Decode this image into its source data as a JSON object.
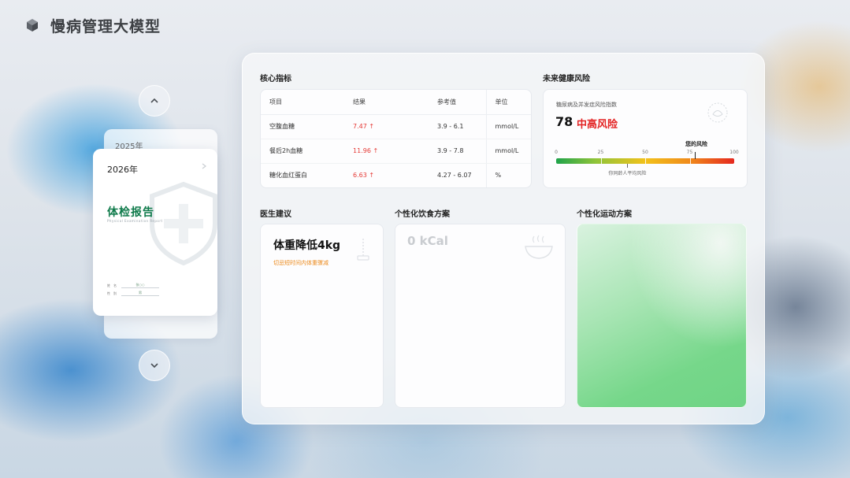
{
  "app": {
    "title": "慢病管理大模型"
  },
  "carousel": {
    "years": [
      "2025年",
      "2026年"
    ],
    "current": {
      "year": "2026年",
      "report_title": "体检报告",
      "report_subtitle": "Physical Examination Report",
      "fields": [
        {
          "label": "姓　名",
          "value": "张○○"
        },
        {
          "label": "性　别",
          "value": "男"
        }
      ]
    }
  },
  "core_metrics": {
    "title": "核心指标",
    "headers": [
      "项目",
      "结果",
      "参考值",
      "单位"
    ],
    "rows": [
      {
        "item": "空腹血糖",
        "result": "7.47 ↑",
        "reference": "3.9 - 6.1",
        "unit": "mmol/L"
      },
      {
        "item": "餐后2h血糖",
        "result": "11.96 ↑",
        "reference": "3.9 - 7.8",
        "unit": "mmol/L"
      },
      {
        "item": "糖化血红蛋白",
        "result": "6.63 ↑",
        "reference": "4.27 - 6.07",
        "unit": "%"
      }
    ]
  },
  "future_risk": {
    "title": "未来健康风险",
    "index_label": "糖尿病及并发症风险指数",
    "score": "78",
    "level": "中高风险",
    "your_risk_label": "您的风险",
    "ticks": [
      "0",
      "25",
      "50",
      "75",
      "100"
    ],
    "score_value": 78,
    "average_label": "你同龄人平均风险",
    "average_value": 40,
    "colors": {
      "low": "#1fa34a",
      "mid": "#f2c21b",
      "high": "#e5281f",
      "level_text": "#e32222"
    }
  },
  "doctor_advice": {
    "title": "医生建议",
    "headline": "体重降低4kg",
    "note": "切忌短时间内体重骤减"
  },
  "diet_plan": {
    "title": "个性化饮食方案",
    "kcal": "0 kCal"
  },
  "exercise_plan": {
    "title": "个性化运动方案"
  }
}
